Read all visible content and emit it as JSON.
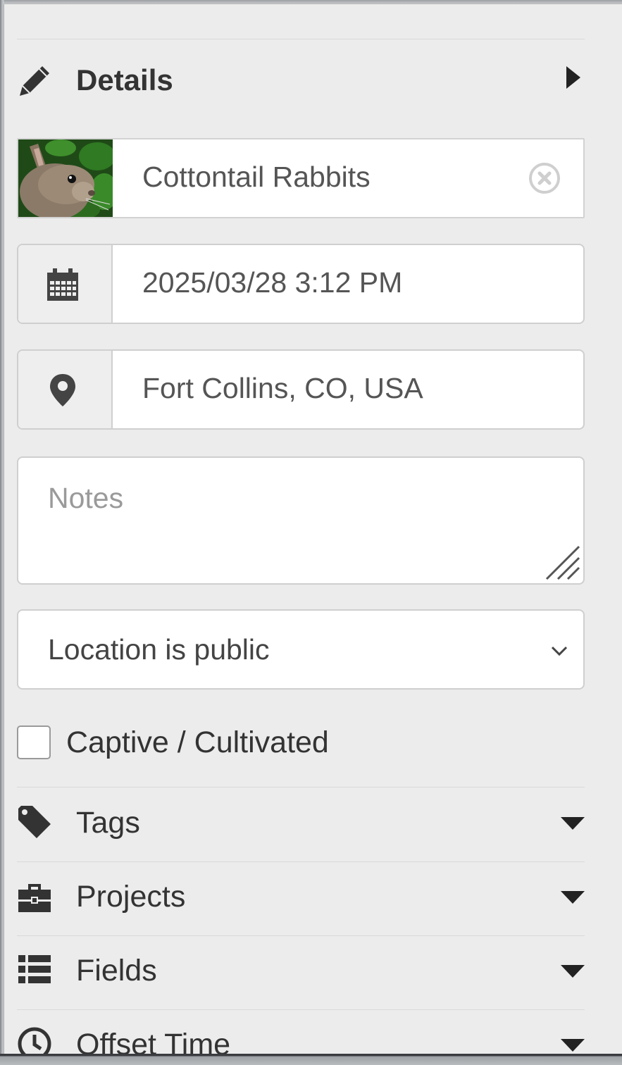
{
  "details": {
    "title": "Details",
    "icon": "pencil-icon",
    "caret_icon": "caret-right-icon"
  },
  "taxon": {
    "name": "Cottontail Rabbits",
    "thumbnail": "rabbit-thumbnail",
    "clear_icon": "clear-circle-icon"
  },
  "date": {
    "value": "2025/03/28 3:12 PM",
    "icon": "calendar-icon"
  },
  "location": {
    "value": "Fort Collins, CO, USA",
    "icon": "map-marker-icon"
  },
  "notes": {
    "placeholder": "Notes",
    "value": ""
  },
  "geoprivacy": {
    "selected": "Location is public"
  },
  "captive": {
    "label": "Captive / Cultivated",
    "checked": false
  },
  "sections": [
    {
      "label": "Tags",
      "icon": "tag-icon"
    },
    {
      "label": "Projects",
      "icon": "briefcase-icon"
    },
    {
      "label": "Fields",
      "icon": "list-icon"
    },
    {
      "label": "Offset Time",
      "icon": "clock-icon"
    }
  ],
  "colors": {
    "panel_bg": "#ececec",
    "text": "#333333",
    "border": "#cfcfcf",
    "placeholder": "#9a9a9a"
  }
}
